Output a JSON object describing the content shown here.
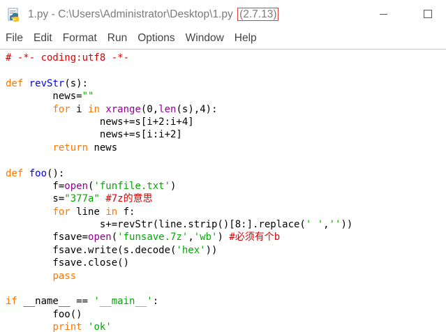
{
  "window": {
    "title": "1.py - C:\\Users\\Administrator\\Desktop\\1.py",
    "version": "(2.7.13)",
    "icon": "python-idle-icon",
    "controls": [
      "minimize-icon",
      "maximize-icon"
    ]
  },
  "menu": [
    "File",
    "Edit",
    "Format",
    "Run",
    "Options",
    "Window",
    "Help"
  ],
  "colors": {
    "keyword": "#ff7700",
    "builtin": "#900090",
    "string": "#00aa00",
    "comment": "#dd0000",
    "definition": "#0000ff",
    "version_outline": "#e53935"
  },
  "code_lines": [
    [
      {
        "t": "cmt",
        "v": "# -*- coding:utf8 -*-"
      }
    ],
    [],
    [
      {
        "t": "kw",
        "v": "def"
      },
      {
        "t": "",
        "v": " "
      },
      {
        "t": "def",
        "v": "revStr"
      },
      {
        "t": "",
        "v": "(s):"
      }
    ],
    [
      {
        "t": "",
        "v": "        news="
      },
      {
        "t": "str",
        "v": "\"\""
      }
    ],
    [
      {
        "t": "",
        "v": "        "
      },
      {
        "t": "kw",
        "v": "for"
      },
      {
        "t": "",
        "v": " i "
      },
      {
        "t": "kw",
        "v": "in"
      },
      {
        "t": "",
        "v": " "
      },
      {
        "t": "bi",
        "v": "xrange"
      },
      {
        "t": "",
        "v": "(0,"
      },
      {
        "t": "bi",
        "v": "len"
      },
      {
        "t": "",
        "v": "(s),4):"
      }
    ],
    [
      {
        "t": "",
        "v": "                news+=s[i+2:i+4]"
      }
    ],
    [
      {
        "t": "",
        "v": "                news+=s[i:i+2]"
      }
    ],
    [
      {
        "t": "",
        "v": "        "
      },
      {
        "t": "kw",
        "v": "return"
      },
      {
        "t": "",
        "v": " news"
      }
    ],
    [],
    [
      {
        "t": "kw",
        "v": "def"
      },
      {
        "t": "",
        "v": " "
      },
      {
        "t": "def",
        "v": "foo"
      },
      {
        "t": "",
        "v": "():"
      }
    ],
    [
      {
        "t": "",
        "v": "        f="
      },
      {
        "t": "bi",
        "v": "open"
      },
      {
        "t": "",
        "v": "("
      },
      {
        "t": "str",
        "v": "'funfile.txt'"
      },
      {
        "t": "",
        "v": ")"
      }
    ],
    [
      {
        "t": "",
        "v": "        s="
      },
      {
        "t": "str",
        "v": "\"377a\""
      },
      {
        "t": "",
        "v": " "
      },
      {
        "t": "cmt",
        "v": "#7z的意思"
      }
    ],
    [
      {
        "t": "",
        "v": "        "
      },
      {
        "t": "kw",
        "v": "for"
      },
      {
        "t": "",
        "v": " line "
      },
      {
        "t": "kw",
        "v": "in"
      },
      {
        "t": "",
        "v": " f:"
      }
    ],
    [
      {
        "t": "",
        "v": "                s+=revStr(line.strip()[8:].replace("
      },
      {
        "t": "str",
        "v": "' '"
      },
      {
        "t": "",
        "v": ","
      },
      {
        "t": "str",
        "v": "''"
      },
      {
        "t": "",
        "v": "))"
      }
    ],
    [
      {
        "t": "",
        "v": "        fsave="
      },
      {
        "t": "bi",
        "v": "open"
      },
      {
        "t": "",
        "v": "("
      },
      {
        "t": "str",
        "v": "'funsave.7z'"
      },
      {
        "t": "",
        "v": ","
      },
      {
        "t": "str",
        "v": "'wb'"
      },
      {
        "t": "",
        "v": ") "
      },
      {
        "t": "cmt",
        "v": "#必须有个b"
      }
    ],
    [
      {
        "t": "",
        "v": "        fsave.write(s.decode("
      },
      {
        "t": "str",
        "v": "'hex'"
      },
      {
        "t": "",
        "v": "))"
      }
    ],
    [
      {
        "t": "",
        "v": "        fsave.close()"
      }
    ],
    [
      {
        "t": "",
        "v": "        "
      },
      {
        "t": "kw",
        "v": "pass"
      }
    ],
    [],
    [
      {
        "t": "kw",
        "v": "if"
      },
      {
        "t": "",
        "v": " __name__ == "
      },
      {
        "t": "str",
        "v": "'__main__'"
      },
      {
        "t": "",
        "v": ":"
      }
    ],
    [
      {
        "t": "",
        "v": "        foo()"
      }
    ],
    [
      {
        "t": "",
        "v": "        "
      },
      {
        "t": "kw",
        "v": "print"
      },
      {
        "t": "",
        "v": " "
      },
      {
        "t": "str",
        "v": "'ok'"
      }
    ]
  ]
}
